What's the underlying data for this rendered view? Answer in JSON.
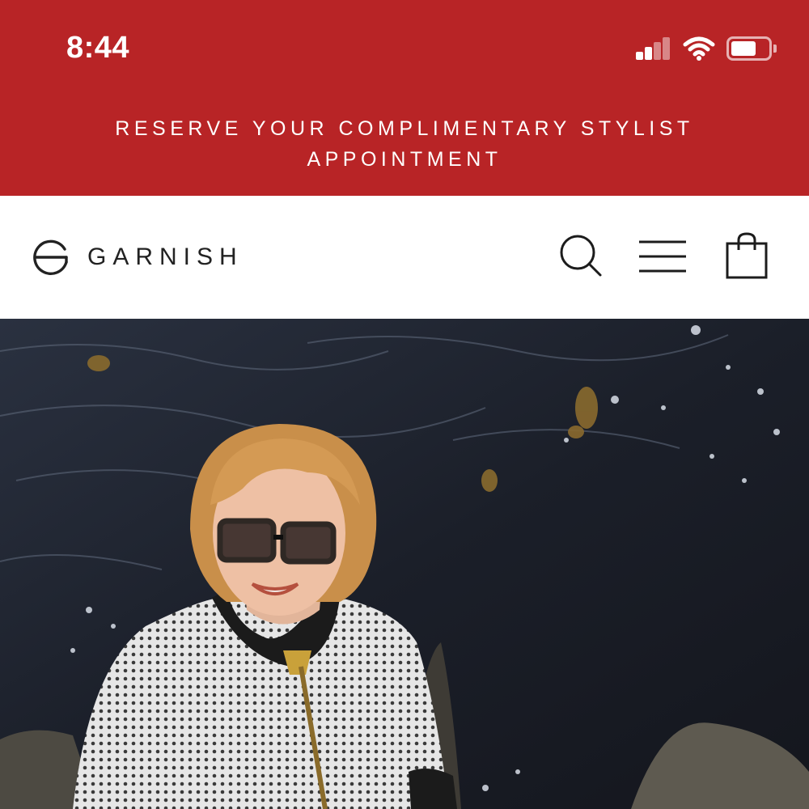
{
  "status_bar": {
    "time": "8:44",
    "icons": [
      "cellular-signal-icon",
      "wifi-icon",
      "battery-icon"
    ],
    "battery_level": 0.6,
    "signal_bars_active": 2
  },
  "promo_banner": {
    "line1": "RESERVE YOUR COMPLIMENTARY STYLIST",
    "line2": "APPOINTMENT"
  },
  "header": {
    "logo_text": "GARNISH",
    "icons": [
      "search-icon",
      "menu-icon",
      "shopping-bag-icon"
    ]
  },
  "hero": {
    "image": "photo-woman-glasses-by-ocean"
  },
  "colors": {
    "brand_red": "#b82426",
    "header_bg": "#ffffff",
    "logo_text": "#222222",
    "icon_stroke": "#1c1c1c"
  }
}
